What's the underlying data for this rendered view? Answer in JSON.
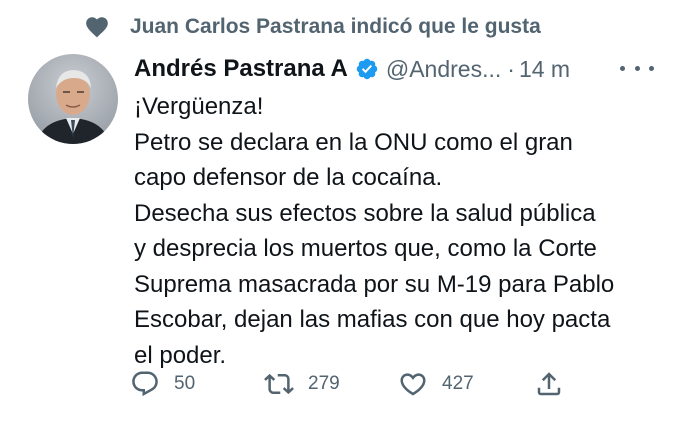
{
  "social_context": {
    "icon": "heart-icon",
    "text": "Juan Carlos Pastrana indicó que le gusta"
  },
  "author": {
    "display_name": "Andrés Pastrana A",
    "verified": true,
    "handle": "@Andres...",
    "separator": "·",
    "time": "14 m"
  },
  "tweet_lines": [
    "¡Vergüenza!",
    "Petro se declara en la ONU como el gran",
    "capo defensor de la cocaína.",
    "Desecha sus efectos sobre la salud pública",
    "y desprecia los muertos que, como la Corte",
    "Suprema masacrada por su M-19 para Pablo",
    "Escobar, dejan las mafias con que hoy pacta",
    "el poder."
  ],
  "actions": {
    "replies": "50",
    "retweets": "279",
    "likes": "427"
  },
  "colors": {
    "text": "#0f1419",
    "secondary": "#536471",
    "verified_blue": "#1d9bf0",
    "background": "#ffffff"
  }
}
